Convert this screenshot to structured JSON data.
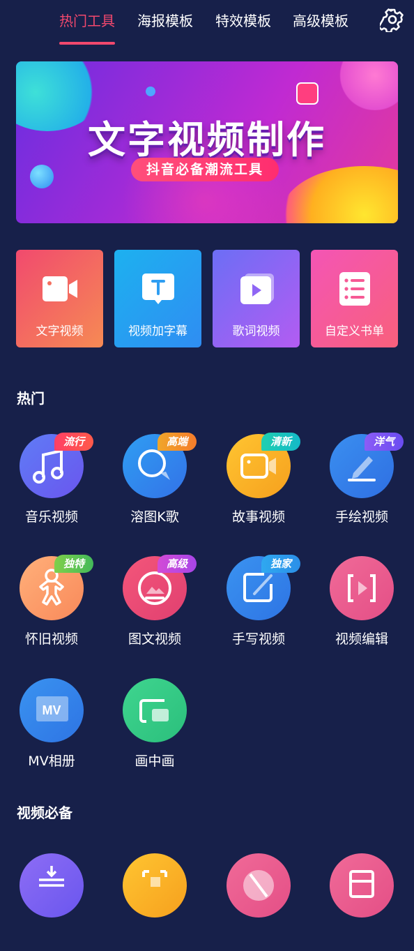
{
  "tabs": [
    {
      "label": "热门工具",
      "active": true
    },
    {
      "label": "海报模板",
      "active": false
    },
    {
      "label": "特效模板",
      "active": false
    },
    {
      "label": "高级模板",
      "active": false
    }
  ],
  "banner": {
    "title": "文字视频制作",
    "subtitle": "抖音必备潮流工具"
  },
  "quick_cards": [
    {
      "label": "文字视频",
      "icon": "video-camera-icon",
      "color_from": "#f14a6e",
      "color_to": "#f68a54"
    },
    {
      "label": "视频加字幕",
      "icon": "subtitle-t-icon",
      "color_from": "#1db1f0",
      "color_to": "#2f8df2"
    },
    {
      "label": "歌词视频",
      "icon": "play-icon",
      "color_from": "#6c6ef5",
      "color_to": "#b35cf2"
    },
    {
      "label": "自定义书单",
      "icon": "list-icon",
      "color_from": "#f455b5",
      "color_to": "#f8607c"
    }
  ],
  "sections": {
    "hot": "热门",
    "essentials": "视频必备"
  },
  "hot_items": [
    {
      "label": "音乐视频",
      "badge": "流行",
      "icon": "music-note-icon"
    },
    {
      "label": "溶图K歌",
      "badge": "高端",
      "icon": "search-chat-icon"
    },
    {
      "label": "故事视频",
      "badge": "清新",
      "icon": "video-camera-icon"
    },
    {
      "label": "手绘视频",
      "badge": "洋气",
      "icon": "pen-icon"
    },
    {
      "label": "怀旧视频",
      "badge": "独特",
      "icon": "gingerbread-icon"
    },
    {
      "label": "图文视频",
      "badge": "高级",
      "icon": "image-text-icon"
    },
    {
      "label": "手写视频",
      "badge": "独家",
      "icon": "handwrite-icon"
    },
    {
      "label": "视频编辑",
      "badge": "",
      "icon": "video-edit-icon"
    },
    {
      "label": "MV相册",
      "badge": "",
      "icon": "mv-album-icon"
    },
    {
      "label": "画中画",
      "badge": "",
      "icon": "picture-in-picture-icon"
    }
  ],
  "colors": {
    "background": "#17204a",
    "accent": "#f2486d"
  }
}
